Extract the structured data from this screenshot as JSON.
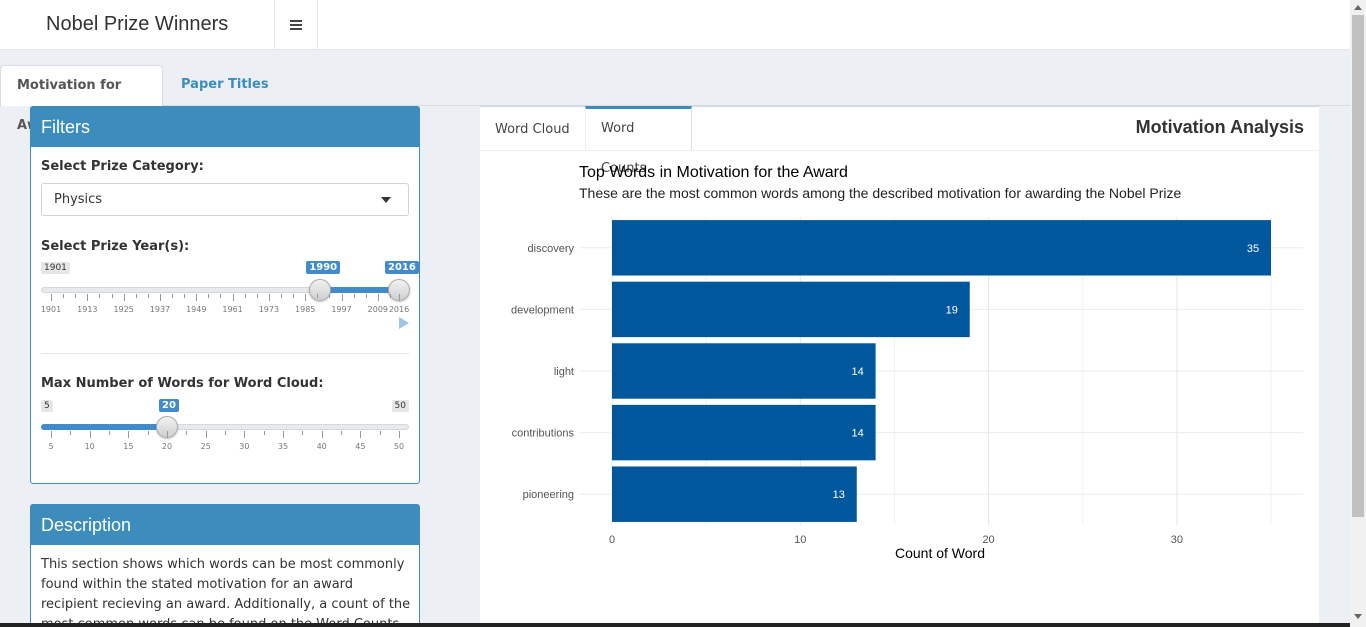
{
  "header": {
    "title": "Nobel Prize Winners",
    "menu_icon": "hamburger-icon"
  },
  "main_tabs": [
    {
      "label": "Motivation for Award",
      "active": true
    },
    {
      "label": "Paper Titles",
      "active": false
    }
  ],
  "filters": {
    "title": "Filters",
    "category": {
      "label": "Select Prize Category:",
      "value": "Physics"
    },
    "year": {
      "label": "Select Prize Year(s):",
      "min": 1901,
      "max": 2016,
      "from": 1990,
      "to": 2016,
      "min_label": "1901",
      "from_label": "1990",
      "to_label": "2016",
      "ticks": [
        "1901",
        "1913",
        "1925",
        "1937",
        "1949",
        "1961",
        "1973",
        "1985",
        "1997",
        "2009",
        "2016"
      ]
    },
    "words": {
      "label": "Max Number of Words for Word Cloud:",
      "min": 5,
      "max": 50,
      "value": 20,
      "min_label": "5",
      "max_label": "50",
      "value_label": "20",
      "ticks": [
        "5",
        "10",
        "15",
        "20",
        "25",
        "30",
        "35",
        "40",
        "45",
        "50"
      ]
    }
  },
  "description": {
    "title": "Description",
    "text": "This section shows which words can be most commonly found within the stated motivation for an award recipient recieving an award. Additionally, a count of the most common words can be found on the Word Counts tab as well."
  },
  "panel": {
    "tabs": [
      {
        "label": "Word Cloud",
        "active": false
      },
      {
        "label": "Word Counts",
        "active": true
      }
    ],
    "title": "Motivation Analysis"
  },
  "chart_data": {
    "type": "bar",
    "orientation": "horizontal",
    "title": "Top Words in Motivation for the Award",
    "subtitle": "These are the most common words among the described motivation for awarding the Nobel Prize",
    "xlabel": "Count of Word",
    "ylabel": "",
    "categories": [
      "discovery",
      "development",
      "light",
      "contributions",
      "pioneering"
    ],
    "values": [
      35,
      19,
      14,
      14,
      13
    ],
    "xlim": [
      0,
      35
    ],
    "xticks": [
      0,
      10,
      20,
      30
    ],
    "bar_color": "#01579b",
    "grid": true
  }
}
